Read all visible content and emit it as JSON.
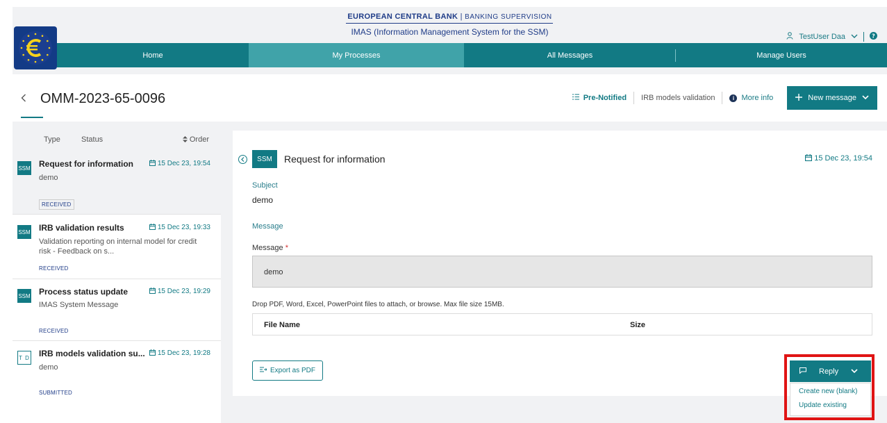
{
  "banner": {
    "org_bold": "EUROPEAN CENTRAL BANK",
    "org_sep": "|",
    "org_sub": "BANKING SUPERVISION",
    "system": "IMAS (Information Management System for the SSM)",
    "user": "TestUser Daa"
  },
  "nav": {
    "items": [
      {
        "label": "Home"
      },
      {
        "label": "My Processes"
      },
      {
        "label": "All Messages"
      },
      {
        "label": "Manage Users"
      }
    ],
    "active_index": 1
  },
  "process": {
    "id": "OMM-2023-65-0096",
    "state": "Pre-Notified",
    "type": "IRB models validation",
    "more_info": "More info",
    "new_message": "New message"
  },
  "list_header": {
    "type": "Type",
    "status": "Status",
    "order": "Order"
  },
  "messages": [
    {
      "badge": "SSM",
      "title": "Request for information",
      "date": "15 Dec 23, 19:54",
      "desc": "demo",
      "status": "RECEIVED"
    },
    {
      "badge": "SSM",
      "title": "IRB validation results",
      "date": "15 Dec 23, 19:33",
      "desc": "Validation reporting on internal model for credit risk - Feedback on s...",
      "status": "RECEIVED"
    },
    {
      "badge": "SSM",
      "title": "Process status update",
      "date": "15 Dec 23, 19:29",
      "desc": "IMAS System Message",
      "status": "RECEIVED"
    },
    {
      "badge": "T D",
      "title": "IRB models validation su...",
      "date": "15 Dec 23, 19:28",
      "desc": "demo",
      "status": "SUBMITTED"
    }
  ],
  "detail": {
    "badge": "SSM",
    "title": "Request for information",
    "date": "15 Dec 23, 19:54",
    "subject_label": "Subject",
    "subject_value": "demo",
    "message_section": "Message",
    "message_label": "Message",
    "required_mark": "*",
    "message_value": "demo",
    "drop_hint": "Drop PDF, Word, Excel, PowerPoint files to attach, or browse. Max file size 15MB.",
    "col_file": "File Name",
    "col_size": "Size",
    "export": "Export as PDF"
  },
  "reply": {
    "label": "Reply",
    "options": [
      "Create new (blank)",
      "Update existing"
    ]
  },
  "colors": {
    "teal": "#127a84",
    "teal_active": "#40a3a9",
    "navy": "#1f3c88",
    "highlight": "#e01414"
  }
}
